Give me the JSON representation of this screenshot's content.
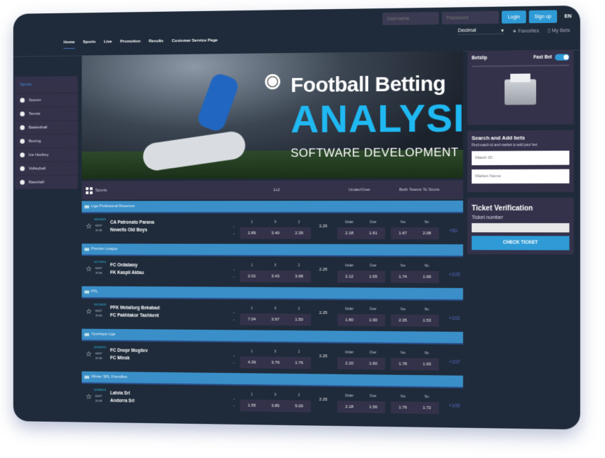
{
  "header": {
    "username_placeholder": "Username",
    "password_placeholder": "Password",
    "login": "Login",
    "signup": "Sign up",
    "language": "EN"
  },
  "nav": {
    "items": [
      "Home",
      "Sports",
      "Live",
      "Promotion",
      "Results",
      "Customer Service Page"
    ],
    "odds_format": "Decimal",
    "favorites": "Favorites",
    "my_bets": "My Bets"
  },
  "sidebar": {
    "title": "Sports",
    "items": [
      "Soccer",
      "Tennis",
      "Basketball",
      "Boxing",
      "Ice Hockey",
      "Volleyball",
      "Baseball"
    ]
  },
  "banner": {
    "line1": "Football Betting",
    "line2": "ANALYSIS",
    "line3": "SOFTWARE DEVELOPMENT"
  },
  "table": {
    "sports_label": "Sports",
    "col_1x2": "1x2",
    "col_ou": "Under/Over",
    "col_btts": "Both Teams To Score",
    "labels": [
      "1",
      "X",
      "2",
      "Under",
      "Over",
      "Yes",
      "No"
    ],
    "leagues": [
      {
        "name": "Liga Profesional Reserves",
        "match": {
          "id": "34814459",
          "date": "04/07",
          "time": "19:30",
          "home": "CA Patronato Parana",
          "away": "Newells Old Boys",
          "odds": [
            "2.89",
            "3.40",
            "2.39"
          ],
          "line": "2.25",
          "ou": [
            "2.18",
            "1.61"
          ],
          "btts": [
            "1.67",
            "2.08"
          ],
          "more": "+50"
        }
      },
      {
        "name": "Premier League",
        "match": {
          "id": "32172653",
          "date": "04/07",
          "time": "19:30",
          "home": "FC Ordabasy",
          "away": "FK Kaspii Aktau",
          "odds": [
            "2.01",
            "3.43",
            "3.68"
          ],
          "line": "2.25",
          "ou": [
            "2.12",
            "1.65"
          ],
          "btts": [
            "1.74",
            "1.99"
          ],
          "more": "+103"
        }
      },
      {
        "name": "PFL",
        "match": {
          "id": "33215828",
          "date": "04/07",
          "time": "19:30",
          "home": "PFK Metallurg Bekabad",
          "away": "FC Pakhtakor Tashkent",
          "odds": [
            "7.04",
            "3.97",
            "1.50"
          ],
          "line": "2.25",
          "ou": [
            "1.80",
            "1.90"
          ],
          "btts": [
            "2.35",
            "1.53"
          ],
          "more": "+102"
        }
      },
      {
        "name": "Vysshaya Liga",
        "match": {
          "id": "32645513",
          "date": "04/07",
          "time": "20:30",
          "home": "FC Dnepr Mogilev",
          "away": "FC Minsk",
          "odds": [
            "4.39",
            "3.79",
            "1.76"
          ],
          "line": "2.25",
          "ou": [
            "2.20",
            "1.60"
          ],
          "btts": [
            "1.78",
            "1.93"
          ],
          "more": "+107"
        }
      },
      {
        "name": "Winter SRL Friendlies",
        "match": {
          "id": "34366226",
          "date": "04/07",
          "time": "20:30",
          "home": "Latvia Srl",
          "away": "Andorra Srl",
          "odds": [
            "1.55",
            "3.85",
            "5.00"
          ],
          "line": "2.25",
          "ou": [
            "2.18",
            "1.56"
          ],
          "btts": [
            "1.76",
            "1.72"
          ],
          "more": "+100"
        }
      }
    ]
  },
  "betslip": {
    "title": "Betslip",
    "fast_bet": "Fast Bet",
    "fast_bet_on": true
  },
  "search_bets": {
    "title": "Search and Add bets",
    "hint": "Find match id and market to add your bet.",
    "match_placeholder": "Match ID",
    "market_placeholder": "Market Name"
  },
  "ticket": {
    "title": "Ticket Verification",
    "label": "Ticket number",
    "button": "CHECK TICKET"
  },
  "colors": {
    "accent": "#2e9ad6",
    "background": "#1f2b3a",
    "panel": "#34324a",
    "league_bar": "#3a8fc8"
  }
}
